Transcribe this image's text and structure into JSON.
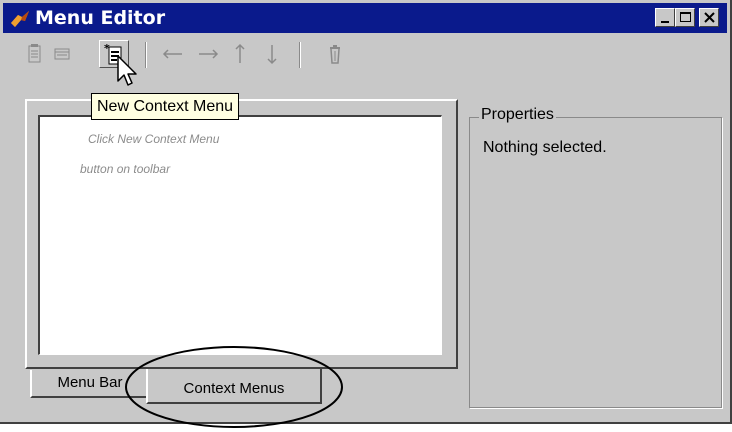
{
  "window": {
    "title": "Menu Editor",
    "colors": {
      "titlebar": "#0a1a8c",
      "face": "#c8c8c8",
      "tooltip_bg": "#ffffe1"
    },
    "caption_buttons": [
      "minimize-icon",
      "maximize-icon",
      "close-icon"
    ]
  },
  "toolbar": {
    "buttons": [
      {
        "icon": "new-menu-icon",
        "state": "disabled"
      },
      {
        "icon": "new-menu-item-icon",
        "state": "disabled"
      },
      {
        "icon": "new-context-menu-icon",
        "state": "pressed"
      },
      {
        "icon": "arrow-left-icon",
        "state": "disabled"
      },
      {
        "icon": "arrow-right-icon",
        "state": "disabled"
      },
      {
        "icon": "arrow-up-icon",
        "state": "disabled"
      },
      {
        "icon": "arrow-down-icon",
        "state": "disabled"
      },
      {
        "icon": "trash-icon",
        "state": "disabled"
      }
    ]
  },
  "tooltip": {
    "text": "New Context Menu"
  },
  "list": {
    "hint_line1": "Click New Context Menu",
    "hint_line2": "button on toolbar"
  },
  "tabs": [
    {
      "label": "Menu Bar",
      "selected": false
    },
    {
      "label": "Context Menus",
      "selected": true
    }
  ],
  "properties": {
    "title": "Properties",
    "text": "Nothing selected."
  }
}
